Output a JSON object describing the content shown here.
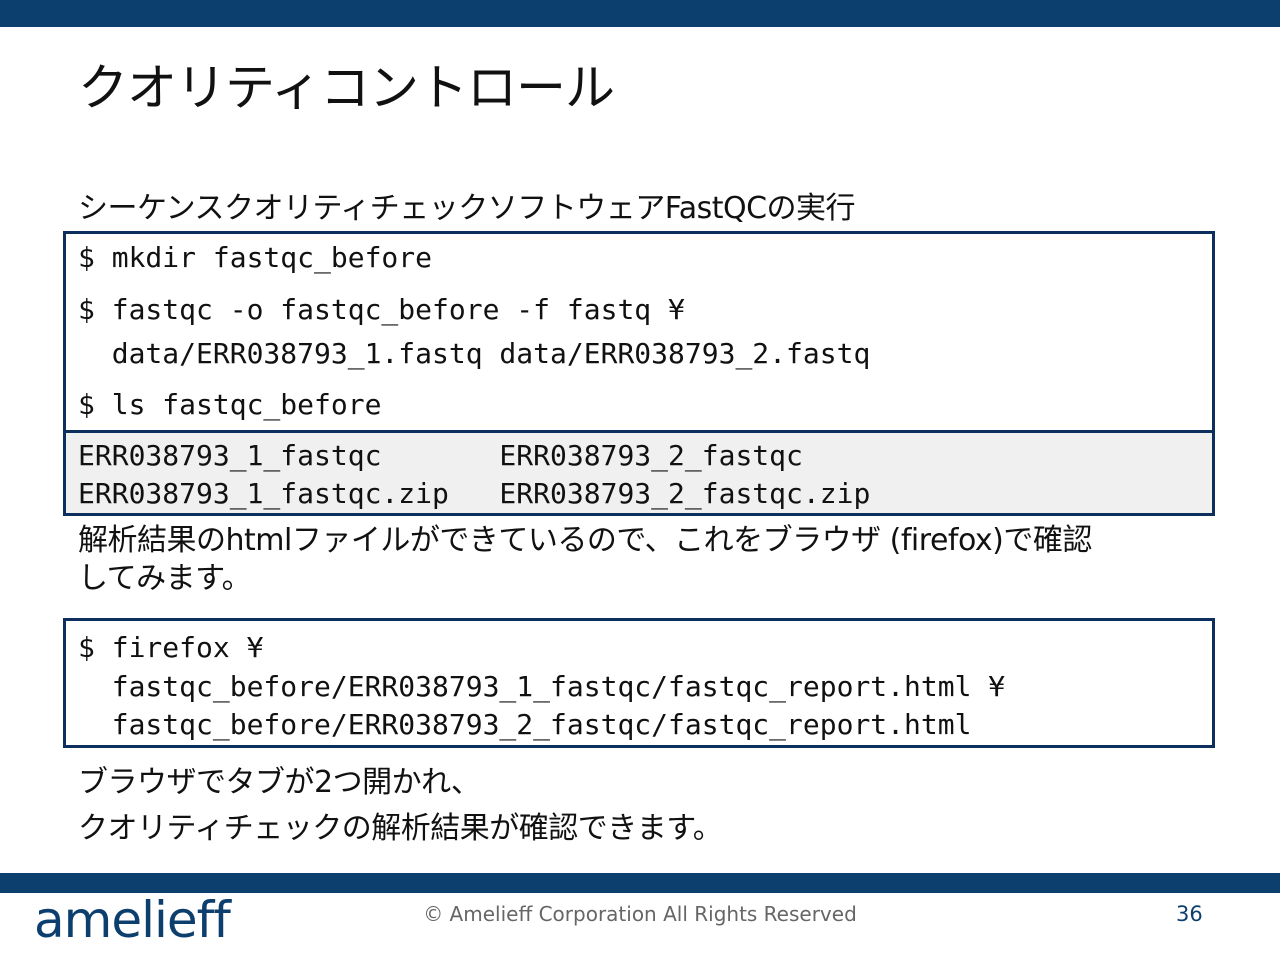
{
  "slide": {
    "title": "クオリティコントロール",
    "subtitle": "シーケンスクオリティチェックソフトウェアFastQCの実行",
    "commands1": [
      "$ mkdir fastqc_before",
      "$ fastqc -o fastqc_before -f fastq ¥",
      "  data/ERR038793_1.fastq data/ERR038793_2.fastq",
      "$ ls fastqc_before"
    ],
    "output": [
      "ERR038793_1_fastqc       ERR038793_2_fastqc",
      "ERR038793_1_fastqc.zip   ERR038793_2_fastqc.zip"
    ],
    "description": [
      "解析結果のhtmlファイルができているので、これをブラウザ (firefox)で確認",
      "してみます。"
    ],
    "commands2": [
      "$ firefox ¥",
      "  fastqc_before/ERR038793_1_fastqc/fastqc_report.html ¥",
      "  fastqc_before/ERR038793_2_fastqc/fastqc_report.html"
    ],
    "closing": [
      "ブラウザでタブが2つ開かれ、",
      "クオリティチェックの解析結果が確認できます。"
    ]
  },
  "footer": {
    "logo": "amelieff",
    "copyright": "© Amelieff Corporation All Rights Reserved",
    "page_number": "36"
  }
}
